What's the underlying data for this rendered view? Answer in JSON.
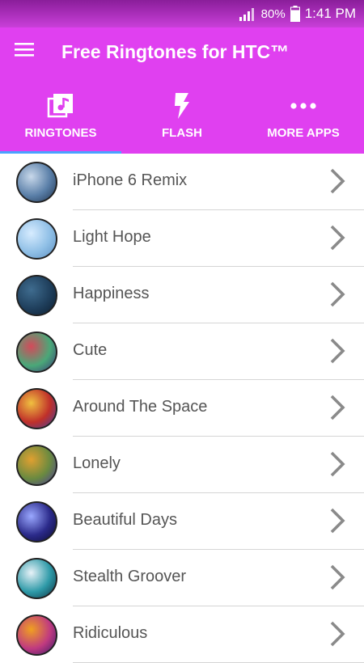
{
  "status_bar": {
    "battery_percent": "80%",
    "time": "1:41 PM",
    "background_color": "#c93fd9"
  },
  "app_bar": {
    "title": "Free Ringtones for HTC™",
    "background_color": "#e040f0"
  },
  "tabs": [
    {
      "label": "RINGTONES",
      "icon": "music-library-icon",
      "selected": true
    },
    {
      "label": "FLASH",
      "icon": "flash-icon",
      "selected": false
    },
    {
      "label": "MORE APPS",
      "icon": "more-dots-icon",
      "selected": false
    }
  ],
  "ringtones": [
    {
      "name": "iPhone 6 Remix",
      "thumb_colors": [
        "#c8d8ea",
        "#5a7fa8",
        "#20344f"
      ]
    },
    {
      "name": "Light Hope",
      "thumb_colors": [
        "#d7ecff",
        "#8fbfe6",
        "#5d8fc0"
      ]
    },
    {
      "name": "Happiness",
      "thumb_colors": [
        "#3f6c8f",
        "#1f3f5c",
        "#0c1d2e"
      ]
    },
    {
      "name": "Cute",
      "thumb_colors": [
        "#d44a5a",
        "#4aa878",
        "#3a3a7a"
      ]
    },
    {
      "name": "Around The Space",
      "thumb_colors": [
        "#f0c040",
        "#c0302a",
        "#4040a0"
      ]
    },
    {
      "name": "Lonely",
      "thumb_colors": [
        "#e0a030",
        "#6a8a40",
        "#4a3a9a"
      ]
    },
    {
      "name": "Beautiful Days",
      "thumb_colors": [
        "#9aa8ff",
        "#2b2a8a",
        "#0a0a30"
      ]
    },
    {
      "name": "Stealth Groover",
      "thumb_colors": [
        "#e8f2f8",
        "#2e9aa8",
        "#0c3040"
      ]
    },
    {
      "name": "Ridiculous",
      "thumb_colors": [
        "#f0a020",
        "#c03a80",
        "#3a1a6a"
      ]
    }
  ]
}
